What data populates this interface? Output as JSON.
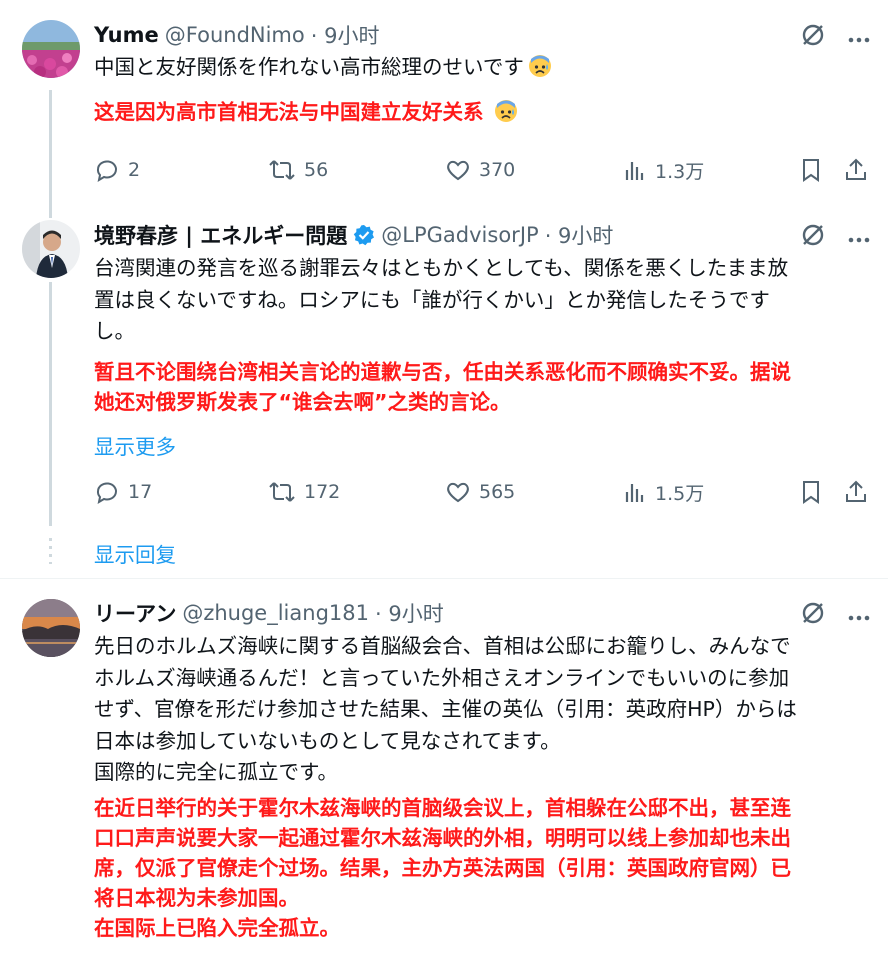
{
  "tweets": [
    {
      "name": "Yume",
      "handle": "@FoundNimo",
      "time": "· 9小时",
      "text_jp": "中国と友好関係を作れない高市総理のせいです",
      "text_cn": "这是因为高市首相无法与中国建立友好关系",
      "actions": {
        "reply": "2",
        "retweet": "56",
        "like": "370",
        "views": "1.3万"
      }
    },
    {
      "name": "境野春彦 | エネルギー問題",
      "handle": "@LPGadvisorJP",
      "time": "· 9小时",
      "text_jp_1": "台湾関連の発言を巡る謝罪云々はともかくとしても、関係を悪くしたまま放",
      "text_jp_2": "置は良くないですね。ロシアにも「誰が行くかい」とか発信したそうです",
      "text_jp_3": "し。",
      "text_cn_1": "暂且不论围绕台湾相关言论的道歉与否，任由关系恶化而不顾确实不妥。据说",
      "text_cn_2": "她还对俄罗斯发表了“谁会去啊”之类的言论。",
      "show_more": "显示更多",
      "actions": {
        "reply": "17",
        "retweet": "172",
        "like": "565",
        "views": "1.5万"
      }
    },
    {
      "name": "リーアン",
      "handle": "@zhuge_liang181",
      "time": "· 9小时",
      "text_jp_1": "先日のホルムズ海峡に関する首脳級会合、首相は公邸にお籠りし、みんなで",
      "text_jp_2": "ホルムズ海峡通るんだ！と言っていた外相さえオンラインでもいいのに参加",
      "text_jp_3": "せず、官僚を形だけ参加させた結果、主催の英仏（引用：英政府HP）からは",
      "text_jp_4": "日本は参加していないものとして見なされてます。",
      "text_jp_5": "国際的に完全に孤立です。",
      "text_cn_1": "在近日举行的关于霍尔木兹海峡的首脑级会议上，首相躲在公邸不出，甚至连",
      "text_cn_2": "口口声声说要大家一起通过霍尔木兹海峡的外相，明明可以线上参加却也未出",
      "text_cn_3": "席，仅派了官僚走个过场。结果，主办方英法两国（引用：英国政府官网）已",
      "text_cn_4": "将日本视为未参加国。",
      "text_cn_5": "在国际上已陷入完全孤立。"
    }
  ],
  "show_replies": "显示回复",
  "colors": {
    "accent": "#1d9bf0",
    "translation": "#ff1a1a",
    "muted": "#536471",
    "line": "#cfd9de"
  }
}
